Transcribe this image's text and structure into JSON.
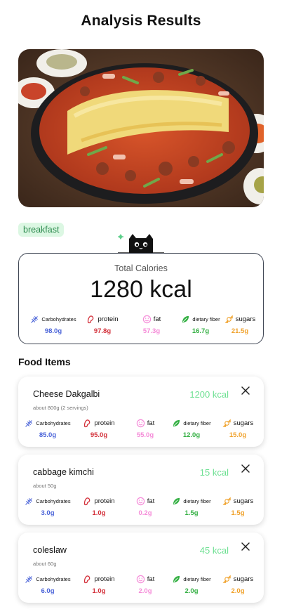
{
  "header": {
    "title": "Analysis Results"
  },
  "meal_tag": "breakfast",
  "summary": {
    "label": "Total Calories",
    "value": "1280 kcal",
    "nutrients": [
      {
        "name": "Carbohydrates",
        "value": "98.0g",
        "color": "#4a63d8",
        "icon": "wheat-icon"
      },
      {
        "name": "protein",
        "value": "97.8g",
        "color": "#d3303a",
        "icon": "protein-icon"
      },
      {
        "name": "fat",
        "value": "57.3g",
        "color": "#f58bd8",
        "icon": "fat-icon"
      },
      {
        "name": "dietary fiber",
        "value": "16.7g",
        "color": "#35b044",
        "icon": "leaf-icon"
      },
      {
        "name": "sugars",
        "value": "21.5g",
        "color": "#f0a22c",
        "icon": "candy-icon"
      }
    ]
  },
  "food_section": {
    "title": "Food Items"
  },
  "food_items": [
    {
      "name": "Cheese Dakgalbi",
      "kcal": "1200 kcal",
      "portion": "about 800g (2 servings)",
      "nutrients": [
        {
          "name": "Carbohydrates",
          "value": "85.0g"
        },
        {
          "name": "protein",
          "value": "95.0g"
        },
        {
          "name": "fat",
          "value": "55.0g"
        },
        {
          "name": "dietary fiber",
          "value": "12.0g"
        },
        {
          "name": "sugars",
          "value": "15.0g"
        }
      ]
    },
    {
      "name": "cabbage kimchi",
      "kcal": "15 kcal",
      "portion": "about 50g",
      "nutrients": [
        {
          "name": "Carbohydrates",
          "value": "3.0g"
        },
        {
          "name": "protein",
          "value": "1.0g"
        },
        {
          "name": "fat",
          "value": "0.2g"
        },
        {
          "name": "dietary fiber",
          "value": "1.5g"
        },
        {
          "name": "sugars",
          "value": "1.5g"
        }
      ]
    },
    {
      "name": "coleslaw",
      "kcal": "45 kcal",
      "portion": "about 60g",
      "nutrients": [
        {
          "name": "Carbohydrates",
          "value": "6.0g"
        },
        {
          "name": "protein",
          "value": "1.0g"
        },
        {
          "name": "fat",
          "value": "2.0g"
        },
        {
          "name": "dietary fiber",
          "value": "2.0g"
        },
        {
          "name": "sugars",
          "value": "2.0g"
        }
      ]
    }
  ]
}
